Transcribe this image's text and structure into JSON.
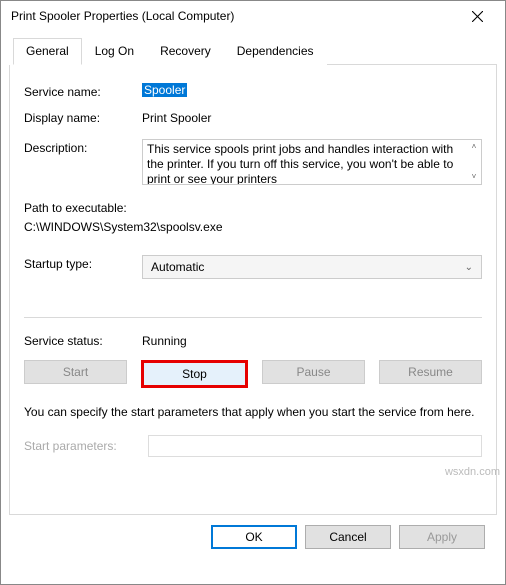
{
  "window": {
    "title": "Print Spooler Properties (Local Computer)"
  },
  "tabs": {
    "general": "General",
    "logon": "Log On",
    "recovery": "Recovery",
    "dependencies": "Dependencies"
  },
  "labels": {
    "service_name": "Service name:",
    "display_name": "Display name:",
    "description": "Description:",
    "path_label": "Path to executable:",
    "startup_type": "Startup type:",
    "service_status": "Service status:",
    "start_params": "Start parameters:"
  },
  "values": {
    "service_name": "Spooler",
    "display_name": "Print Spooler",
    "description": "This service spools print jobs and handles interaction with the printer.  If you turn off this service, you won't be able to print or see your printers",
    "path": "C:\\WINDOWS\\System32\\spoolsv.exe",
    "startup_type": "Automatic",
    "service_status": "Running"
  },
  "buttons": {
    "start": "Start",
    "stop": "Stop",
    "pause": "Pause",
    "resume": "Resume",
    "ok": "OK",
    "cancel": "Cancel",
    "apply": "Apply"
  },
  "note": "You can specify the start parameters that apply when you start the service from here.",
  "watermark": "wsxdn.com"
}
